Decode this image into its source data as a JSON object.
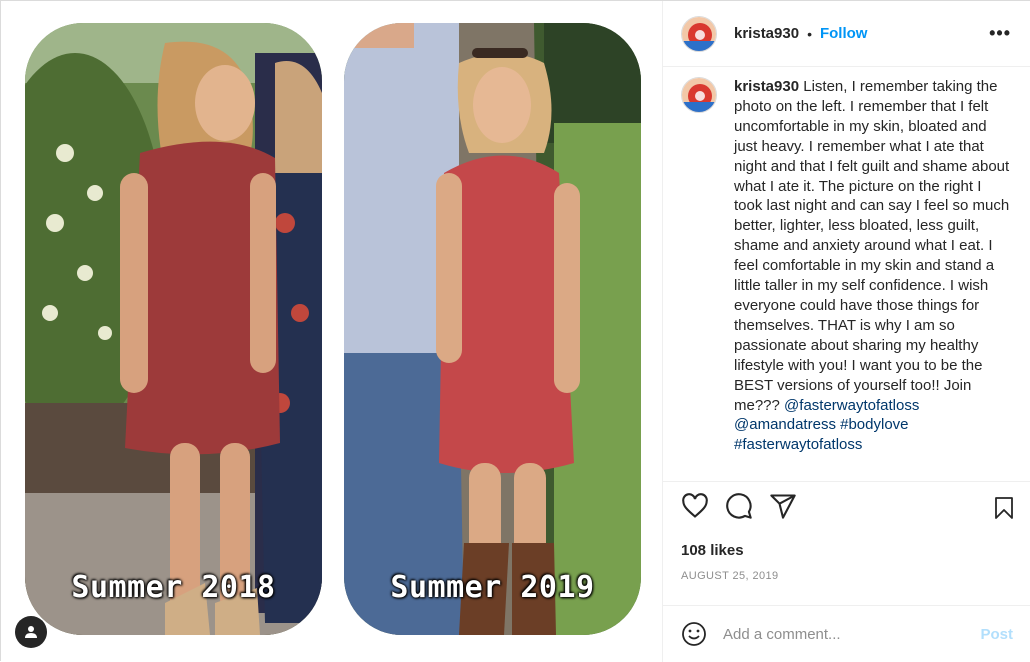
{
  "post": {
    "username": "krista930",
    "follow_label": "Follow",
    "separator": "•",
    "more_label": "•••",
    "caption_text": "Listen, I remember taking the photo on the left. I remember that I felt uncomfortable in my skin, bloated and just heavy. I remember what I ate that night and that I felt guilt and shame about what I ate it. The picture on the right I took last night and can say I feel so much better, lighter, less bloated, less guilt, shame and anxiety around what I eat. I feel comfortable in my skin and stand a little taller in my self confidence. I wish everyone could have those things for themselves. THAT is why I am so passionate about sharing my healthy lifestyle with you! I want you to be the BEST versions of yourself too!! Join me???",
    "mentions": [
      "@fasterwaytofatloss",
      "@amandatress"
    ],
    "hashtags": [
      "#bodylove",
      "#fasterwaytofatloss"
    ],
    "likes": "108 likes",
    "date": "AUGUST 25, 2019"
  },
  "media": {
    "left_label": "Summer 2018",
    "right_label": "Summer 2019"
  },
  "comment_box": {
    "placeholder": "Add a comment...",
    "post_label": "Post"
  },
  "icons": [
    "heart-icon",
    "comment-icon",
    "share-icon",
    "bookmark-icon",
    "emoji-icon",
    "user-tag-icon",
    "more-icon"
  ],
  "colors": {
    "link": "#0095f6",
    "tag": "#00376b",
    "post_disabled": "#b2dffc",
    "muted": "#8e8e8e"
  }
}
